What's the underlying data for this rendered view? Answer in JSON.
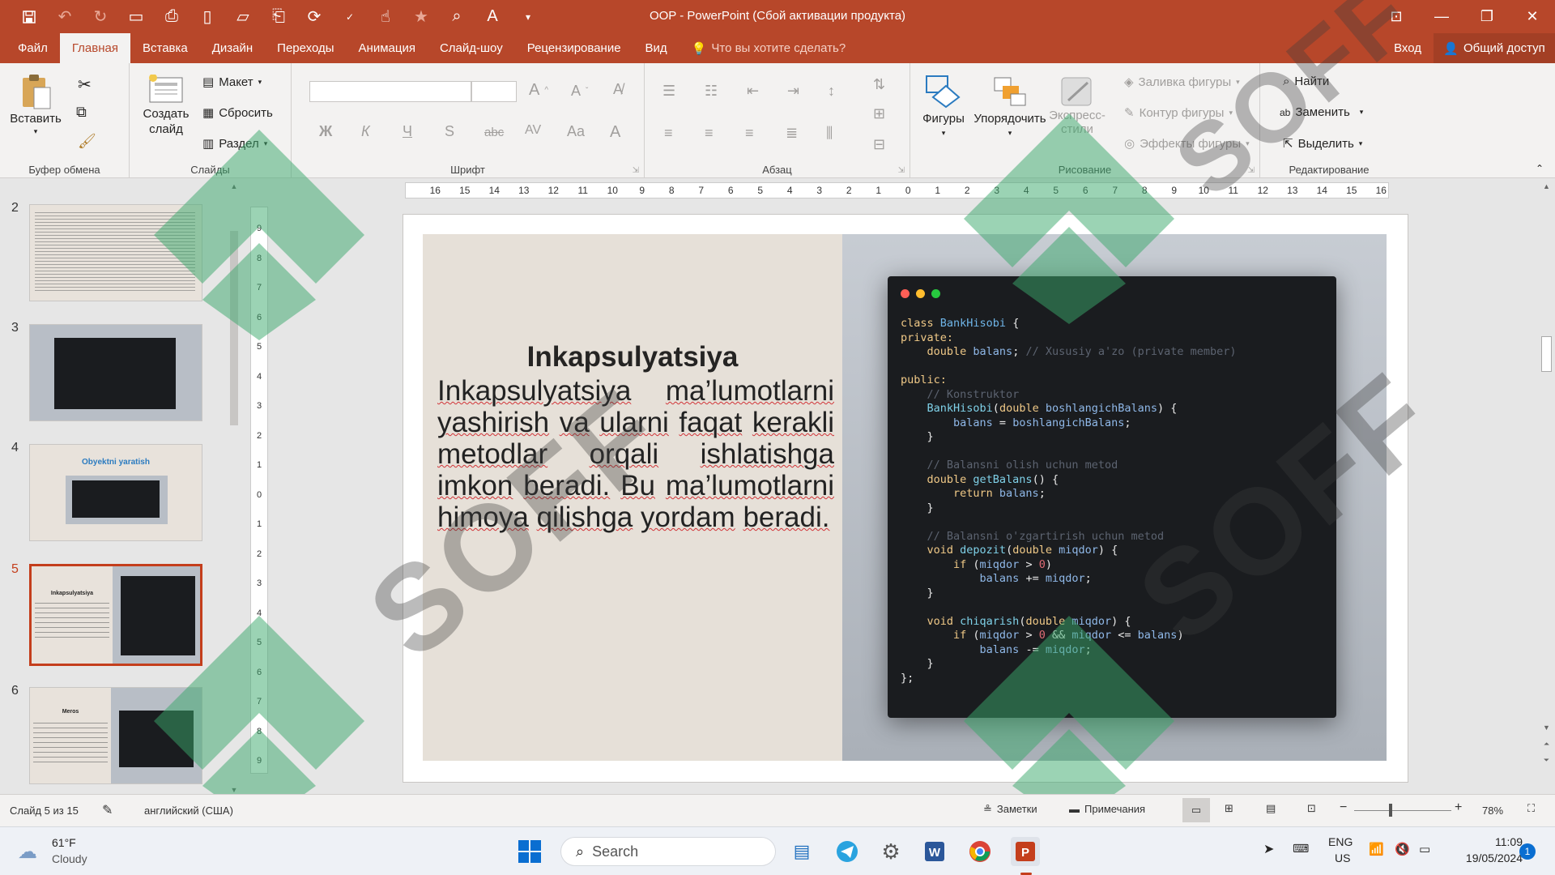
{
  "window": {
    "title": "OOP - PowerPoint (Сбой активации продукта)"
  },
  "tabs": [
    "Файл",
    "Главная",
    "Вставка",
    "Дизайн",
    "Переходы",
    "Анимация",
    "Слайд-шоу",
    "Рецензирование",
    "Вид"
  ],
  "tell_me": "Что вы хотите сделать?",
  "signin": "Вход",
  "share": "Общий доступ",
  "ribbon": {
    "clipboard": {
      "label": "Буфер обмена",
      "paste": "Вставить"
    },
    "slides": {
      "label": "Слайды",
      "new_slide_1": "Создать",
      "new_slide_2": "слайд",
      "layout": "Макет",
      "reset": "Сбросить",
      "section": "Раздел"
    },
    "font": {
      "label": "Шрифт",
      "bold": "Ж",
      "italic": "К",
      "underline": "Ч",
      "shadow": "S",
      "strike": "abc",
      "spacing": "AV",
      "case": "Aa",
      "color": "A"
    },
    "paragraph": {
      "label": "Абзац"
    },
    "drawing": {
      "label": "Рисование",
      "shapes": "Фигуры",
      "arrange": "Упорядочить",
      "quick_styles_1": "Экспресс-",
      "quick_styles_2": "стили",
      "fill": "Заливка фигуры",
      "outline": "Контур фигуры",
      "effects": "Эффекты фигуры"
    },
    "editing": {
      "label": "Редактирование",
      "find": "Найти",
      "replace": "Заменить",
      "select": "Выделить"
    }
  },
  "thumbnails": [
    {
      "num": "2"
    },
    {
      "num": "3"
    },
    {
      "num": "4",
      "title": "Obyektni yaratish"
    },
    {
      "num": "5",
      "title": "Inkapsulyatsiya"
    },
    {
      "num": "6",
      "title": "Meros"
    }
  ],
  "ruler_h": [
    "16",
    "15",
    "14",
    "13",
    "12",
    "11",
    "10",
    "9",
    "8",
    "7",
    "6",
    "5",
    "4",
    "3",
    "2",
    "1",
    "0",
    "1",
    "2",
    "3",
    "4",
    "5",
    "6",
    "7",
    "8",
    "9",
    "10",
    "11",
    "12",
    "13",
    "14",
    "15",
    "16"
  ],
  "ruler_v": [
    "9",
    "8",
    "7",
    "6",
    "5",
    "4",
    "3",
    "2",
    "1",
    "0",
    "1",
    "2",
    "3",
    "4",
    "5",
    "6",
    "7",
    "8",
    "9"
  ],
  "slide": {
    "title": "Inkapsulyatsiya",
    "body_words": [
      "Inkapsulyatsiya",
      "ma’lumotlarni",
      "yashirish",
      "va",
      "ularni",
      "faqat",
      "kerakli",
      "metodlar",
      "orqali",
      "ishlatishga",
      "imkon",
      "beradi.",
      "Bu",
      "ma’lumotlarni",
      "himoya",
      "qilishga",
      "yordam",
      "beradi."
    ],
    "code_lines": [
      [
        {
          "t": "class ",
          "c": "kw"
        },
        {
          "t": "BankHisobi",
          "c": "cls"
        },
        {
          "t": " {",
          "c": ""
        }
      ],
      [
        {
          "t": "private:",
          "c": "kw"
        }
      ],
      [
        {
          "t": "    double ",
          "c": "kw"
        },
        {
          "t": "balans",
          "c": "var"
        },
        {
          "t": "; ",
          "c": ""
        },
        {
          "t": "// Xususiy a'zo (private member)",
          "c": "cm"
        }
      ],
      [
        {
          "t": "",
          "c": ""
        }
      ],
      [
        {
          "t": "public:",
          "c": "kw"
        }
      ],
      [
        {
          "t": "    // Konstruktor",
          "c": "cm"
        }
      ],
      [
        {
          "t": "    BankHisobi",
          "c": "fn"
        },
        {
          "t": "(",
          "c": ""
        },
        {
          "t": "double ",
          "c": "kw"
        },
        {
          "t": "boshlangichBalans",
          "c": "var"
        },
        {
          "t": ") {",
          "c": ""
        }
      ],
      [
        {
          "t": "        balans",
          "c": "var"
        },
        {
          "t": " = ",
          "c": ""
        },
        {
          "t": "boshlangichBalans",
          "c": "var"
        },
        {
          "t": ";",
          "c": ""
        }
      ],
      [
        {
          "t": "    }",
          "c": ""
        }
      ],
      [
        {
          "t": "",
          "c": ""
        }
      ],
      [
        {
          "t": "    // Balansni olish uchun metod",
          "c": "cm"
        }
      ],
      [
        {
          "t": "    double ",
          "c": "kw"
        },
        {
          "t": "getBalans",
          "c": "fn"
        },
        {
          "t": "() {",
          "c": ""
        }
      ],
      [
        {
          "t": "        return ",
          "c": "kw"
        },
        {
          "t": "balans",
          "c": "var"
        },
        {
          "t": ";",
          "c": ""
        }
      ],
      [
        {
          "t": "    }",
          "c": ""
        }
      ],
      [
        {
          "t": "",
          "c": ""
        }
      ],
      [
        {
          "t": "    // Balansni o'zgartirish uchun metod",
          "c": "cm"
        }
      ],
      [
        {
          "t": "    void ",
          "c": "kw"
        },
        {
          "t": "depozit",
          "c": "fn"
        },
        {
          "t": "(",
          "c": ""
        },
        {
          "t": "double ",
          "c": "kw"
        },
        {
          "t": "miqdor",
          "c": "var"
        },
        {
          "t": ") {",
          "c": ""
        }
      ],
      [
        {
          "t": "        if ",
          "c": "kw"
        },
        {
          "t": "(",
          "c": ""
        },
        {
          "t": "miqdor",
          "c": "var"
        },
        {
          "t": " > ",
          "c": ""
        },
        {
          "t": "0",
          "c": "num"
        },
        {
          "t": ")",
          "c": ""
        }
      ],
      [
        {
          "t": "            balans",
          "c": "var"
        },
        {
          "t": " += ",
          "c": ""
        },
        {
          "t": "miqdor",
          "c": "var"
        },
        {
          "t": ";",
          "c": ""
        }
      ],
      [
        {
          "t": "    }",
          "c": ""
        }
      ],
      [
        {
          "t": "",
          "c": ""
        }
      ],
      [
        {
          "t": "    void ",
          "c": "kw"
        },
        {
          "t": "chiqarish",
          "c": "fn"
        },
        {
          "t": "(",
          "c": ""
        },
        {
          "t": "double ",
          "c": "kw"
        },
        {
          "t": "miqdor",
          "c": "var"
        },
        {
          "t": ") {",
          "c": ""
        }
      ],
      [
        {
          "t": "        if ",
          "c": "kw"
        },
        {
          "t": "(",
          "c": ""
        },
        {
          "t": "miqdor",
          "c": "var"
        },
        {
          "t": " > ",
          "c": ""
        },
        {
          "t": "0",
          "c": "num"
        },
        {
          "t": " && ",
          "c": ""
        },
        {
          "t": "miqdor",
          "c": "var"
        },
        {
          "t": " <= ",
          "c": ""
        },
        {
          "t": "balans",
          "c": "var"
        },
        {
          "t": ")",
          "c": ""
        }
      ],
      [
        {
          "t": "            balans",
          "c": "var"
        },
        {
          "t": " -= ",
          "c": ""
        },
        {
          "t": "miqdor",
          "c": "var"
        },
        {
          "t": ";",
          "c": ""
        }
      ],
      [
        {
          "t": "    }",
          "c": ""
        }
      ],
      [
        {
          "t": "};",
          "c": ""
        }
      ]
    ]
  },
  "status": {
    "slide": "Слайд 5 из 15",
    "language": "английский (США)",
    "notes": "Заметки",
    "comments": "Примечания",
    "zoom": "78%"
  },
  "taskbar": {
    "temp": "61°F",
    "weather": "Cloudy",
    "search": "Search",
    "lang1": "ENG",
    "lang2": "US",
    "time": "11:09",
    "date": "19/05/2024",
    "badge": "1"
  },
  "watermark": "SOFF",
  "colors": {
    "accent": "#b7472a",
    "selection": "#c43e1c"
  }
}
